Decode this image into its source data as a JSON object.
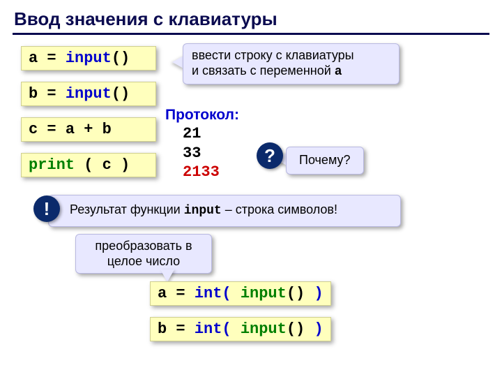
{
  "title": "Ввод значения с клавиатуры",
  "code1": {
    "lhs": "a",
    "eq": "=",
    "fn": "input",
    "par": "()"
  },
  "code2": {
    "lhs": "b",
    "eq": "=",
    "fn": "input",
    "par": "()"
  },
  "code3": {
    "lhs": "c",
    "eq": "=",
    "expr": "a + b"
  },
  "code4": {
    "fn": "print",
    "arg": "( c )"
  },
  "code5": {
    "lhs": "a",
    "eq": "=",
    "outer": "int(",
    "fn": "input",
    "par": "()",
    "close": ")"
  },
  "code6": {
    "lhs": "b",
    "eq": "=",
    "outer": "int(",
    "fn": "input",
    "par": "()",
    "close": ")"
  },
  "callout_input_line1": "ввести строку с клавиатуры",
  "callout_input_line2a": "и связать с переменной ",
  "callout_input_line2b": "a",
  "protocol_label": "Протокол:",
  "protocol": {
    "v1": "21",
    "v2": "33",
    "v3": "2133"
  },
  "badge_q": "?",
  "why": "Почему?",
  "badge_ex": "!",
  "result_a": "Результат функции ",
  "result_b": "input",
  "result_c": " – строка символов!",
  "convert_a": "преобразовать в",
  "convert_b": "целое число"
}
